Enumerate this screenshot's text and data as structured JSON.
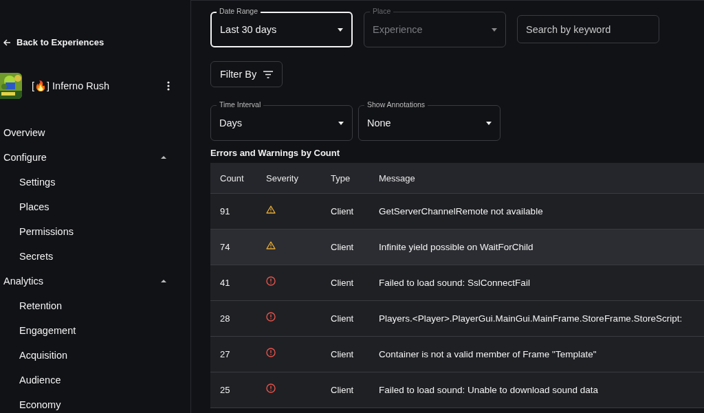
{
  "sidebar": {
    "back_link": "Back to Experiences",
    "experience": {
      "name": "[🔥] Inferno Rush"
    },
    "nav": [
      {
        "label": "Overview"
      },
      {
        "label": "Configure",
        "expanded": true,
        "children": [
          {
            "label": "Settings"
          },
          {
            "label": "Places"
          },
          {
            "label": "Permissions"
          },
          {
            "label": "Secrets"
          }
        ]
      },
      {
        "label": "Analytics",
        "expanded": true,
        "children": [
          {
            "label": "Retention"
          },
          {
            "label": "Engagement"
          },
          {
            "label": "Acquisition"
          },
          {
            "label": "Audience"
          },
          {
            "label": "Economy"
          }
        ]
      }
    ]
  },
  "filters": {
    "date_range": {
      "label": "Date Range",
      "value": "Last 30 days",
      "focused": true,
      "disabled": false
    },
    "place": {
      "label": "Place",
      "value": "Experience",
      "focused": false,
      "disabled": true
    },
    "search": {
      "placeholder": "Search by keyword"
    },
    "filter_button": "Filter By",
    "time_interval": {
      "label": "Time Interval",
      "value": "Days",
      "focused": false,
      "disabled": false
    },
    "annotations": {
      "label": "Show Annotations",
      "value": "None",
      "focused": false,
      "disabled": false
    }
  },
  "table": {
    "title": "Errors and Warnings by Count",
    "columns": [
      "Count",
      "Severity",
      "Type",
      "Message"
    ],
    "rows": [
      {
        "count": "91",
        "kind": "warning",
        "type": "Client",
        "message": "GetServerChannelRemote not available",
        "highlighted": false
      },
      {
        "count": "74",
        "kind": "warning",
        "type": "Client",
        "message": "Infinite yield possible on WaitForChild",
        "highlighted": true
      },
      {
        "count": "41",
        "kind": "error",
        "type": "Client",
        "message": "Failed to load sound: SslConnectFail",
        "highlighted": false
      },
      {
        "count": "28",
        "kind": "error",
        "type": "Client",
        "message": "Players.<Player>.PlayerGui.MainGui.MainFrame.StoreFrame.StoreScript:",
        "highlighted": false
      },
      {
        "count": "27",
        "kind": "error",
        "type": "Client",
        "message": "Container is not a valid member of Frame \"Template\"",
        "highlighted": false
      },
      {
        "count": "25",
        "kind": "error",
        "type": "Client",
        "message": "Failed to load sound: Unable to download sound data",
        "highlighted": false
      }
    ]
  }
}
